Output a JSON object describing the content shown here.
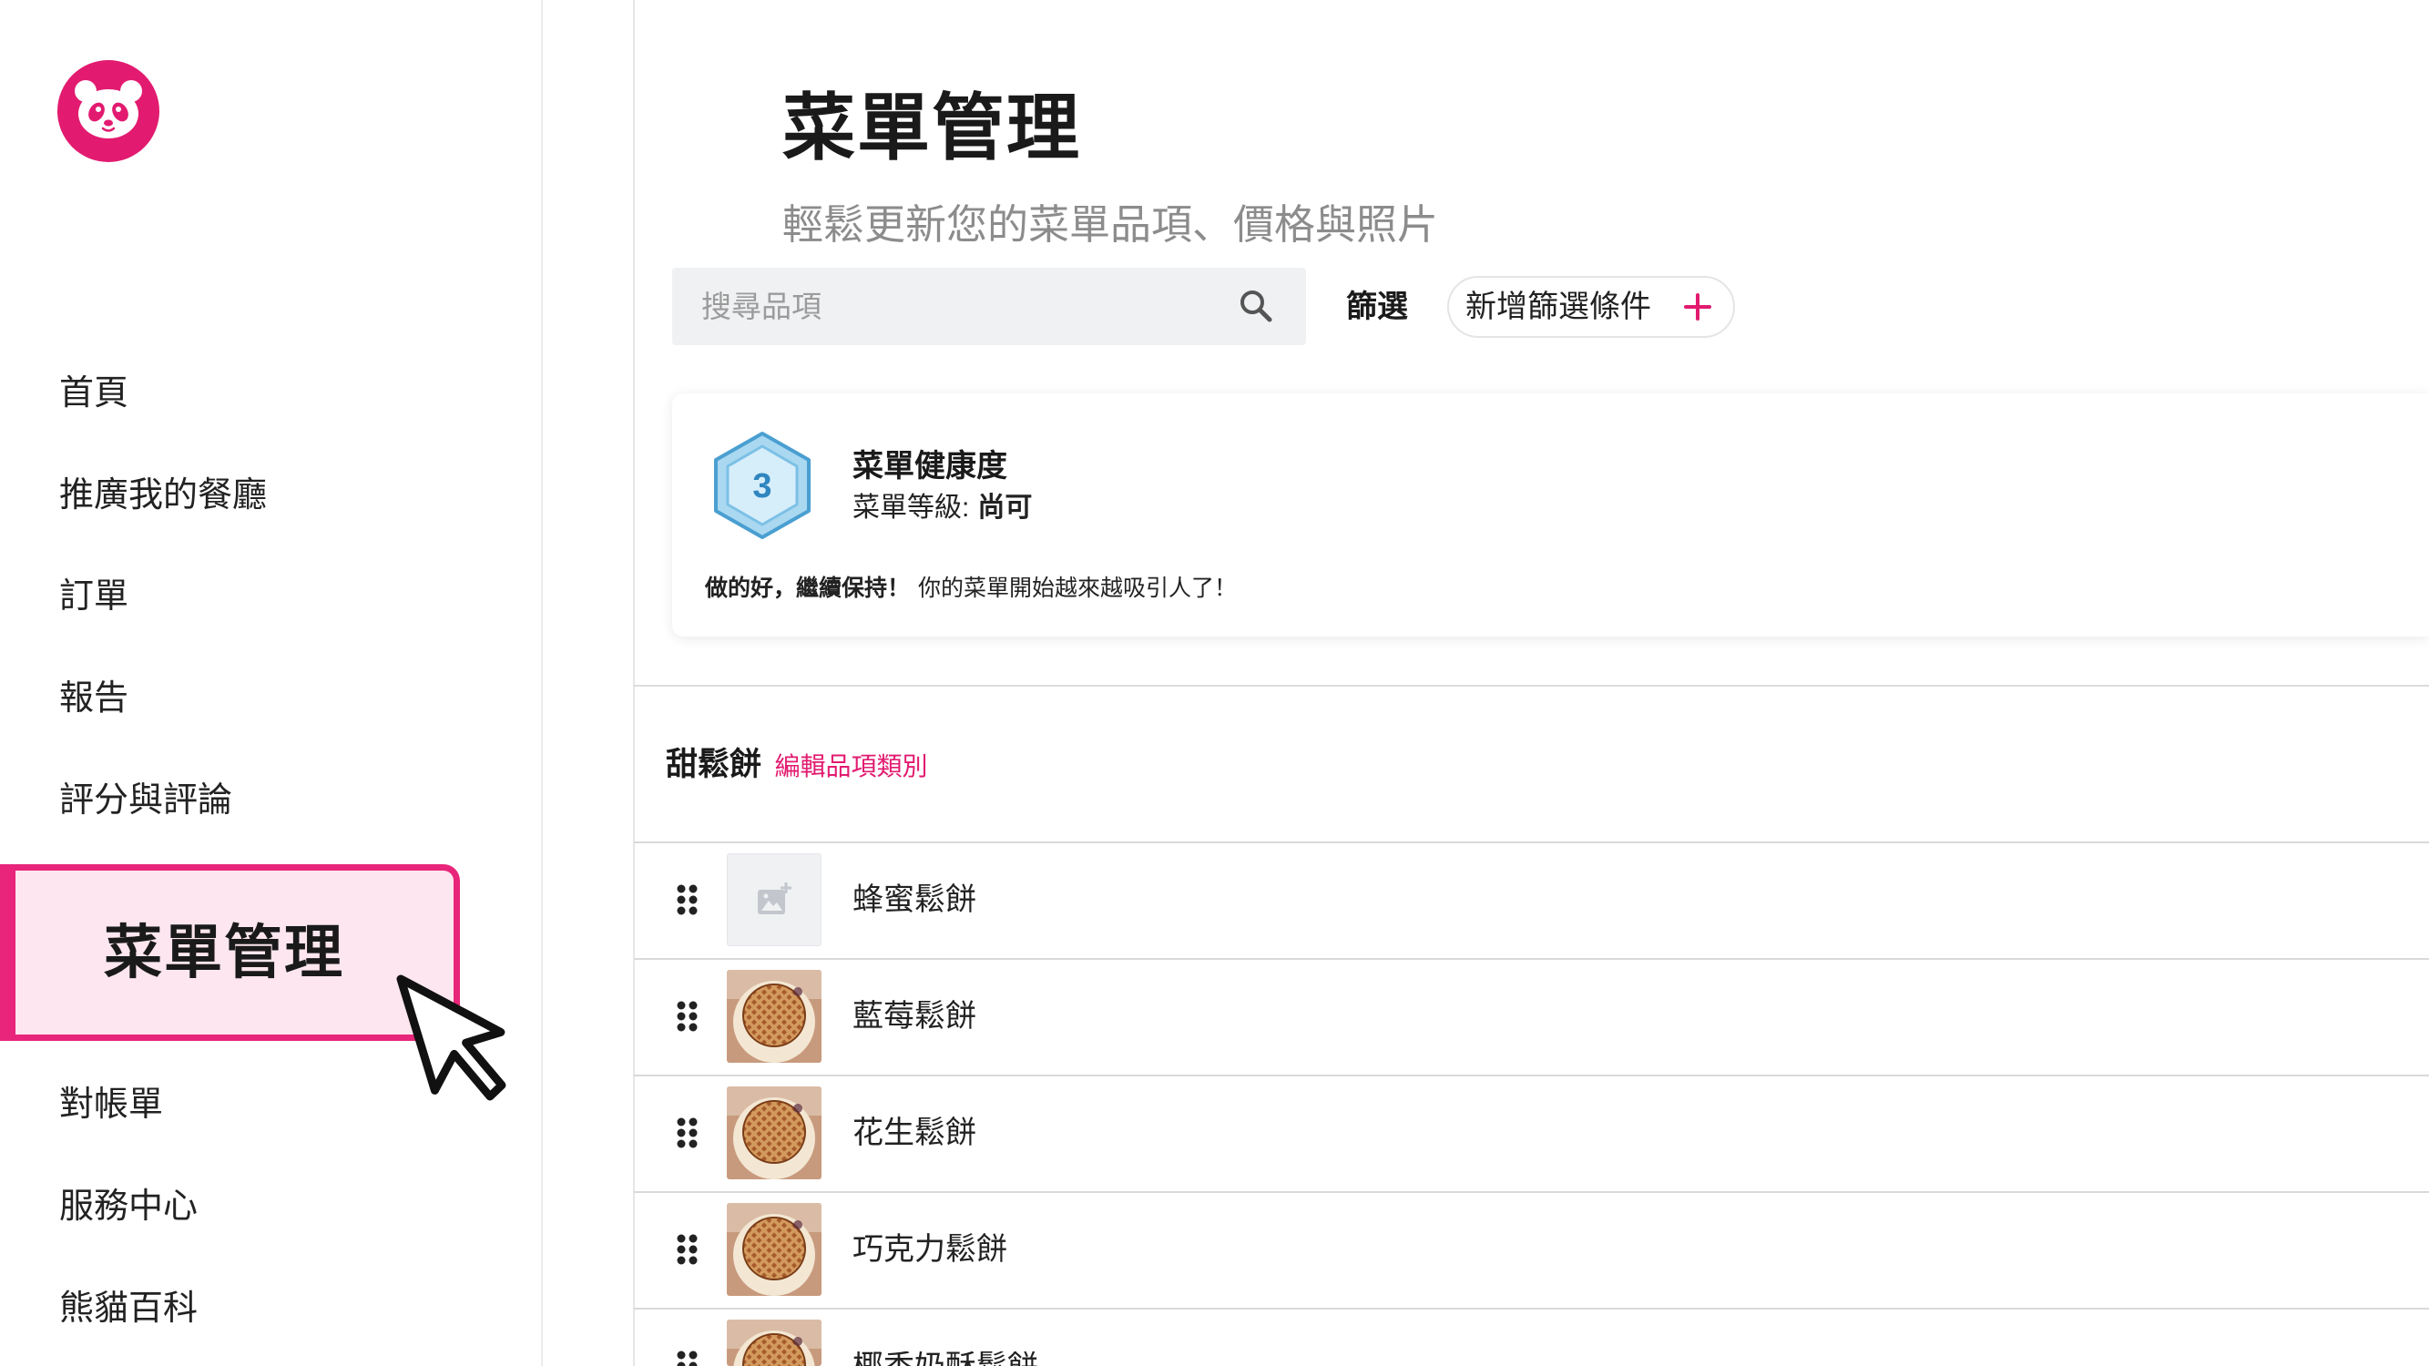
{
  "colors": {
    "brand_pink": "#e21b70",
    "active_nav_background": "#fde6ef",
    "active_nav_border": "#e8257a",
    "text_primary": "#1f1f1f",
    "text_secondary": "#8c8c8c",
    "divider": "#d9d9d9",
    "badge_blue": "#4a9fd1"
  },
  "icons": {
    "logo": "panda-logo-icon",
    "search": "search-icon",
    "add_filter": "plus-icon",
    "health_badge": "shield-badge-icon",
    "drag_handle": "drag-handle-icon",
    "photo_placeholder": "add-photo-icon",
    "cursor": "mouse-cursor-icon"
  },
  "sidebar": {
    "nav": [
      {
        "label": "首頁",
        "active": false
      },
      {
        "label": "推廣我的餐廳",
        "active": false
      },
      {
        "label": "訂單",
        "active": false
      },
      {
        "label": "報告",
        "active": false
      },
      {
        "label": "評分與評論",
        "active": false
      },
      {
        "label": "菜單管理",
        "active": true
      },
      {
        "label": "對帳單",
        "active": false
      },
      {
        "label": "服務中心",
        "active": false
      },
      {
        "label": "熊貓百科",
        "active": false
      }
    ]
  },
  "header": {
    "title": "菜單管理",
    "subtitle": "輕鬆更新您的菜單品項、價格與照片"
  },
  "toolbar": {
    "search_placeholder": "搜尋品項",
    "search_value": "",
    "filter_label": "篩選",
    "add_filter_label": "新增篩選條件"
  },
  "menu_health": {
    "title": "菜單健康度",
    "level_label": "菜單等級:",
    "level_value": "尚可",
    "score": "3",
    "message_highlight": "做的好，繼續保持！",
    "message": "你的菜單開始越來越吸引人了！"
  },
  "category": {
    "name": "甜鬆餅",
    "edit_label": "編輯品項類別",
    "items": [
      {
        "name": "蜂蜜鬆餅",
        "has_photo": false
      },
      {
        "name": "藍莓鬆餅",
        "has_photo": true
      },
      {
        "name": "花生鬆餅",
        "has_photo": true
      },
      {
        "name": "巧克力鬆餅",
        "has_photo": true
      },
      {
        "name": "椰香奶酥鬆餅",
        "has_photo": true
      }
    ]
  }
}
